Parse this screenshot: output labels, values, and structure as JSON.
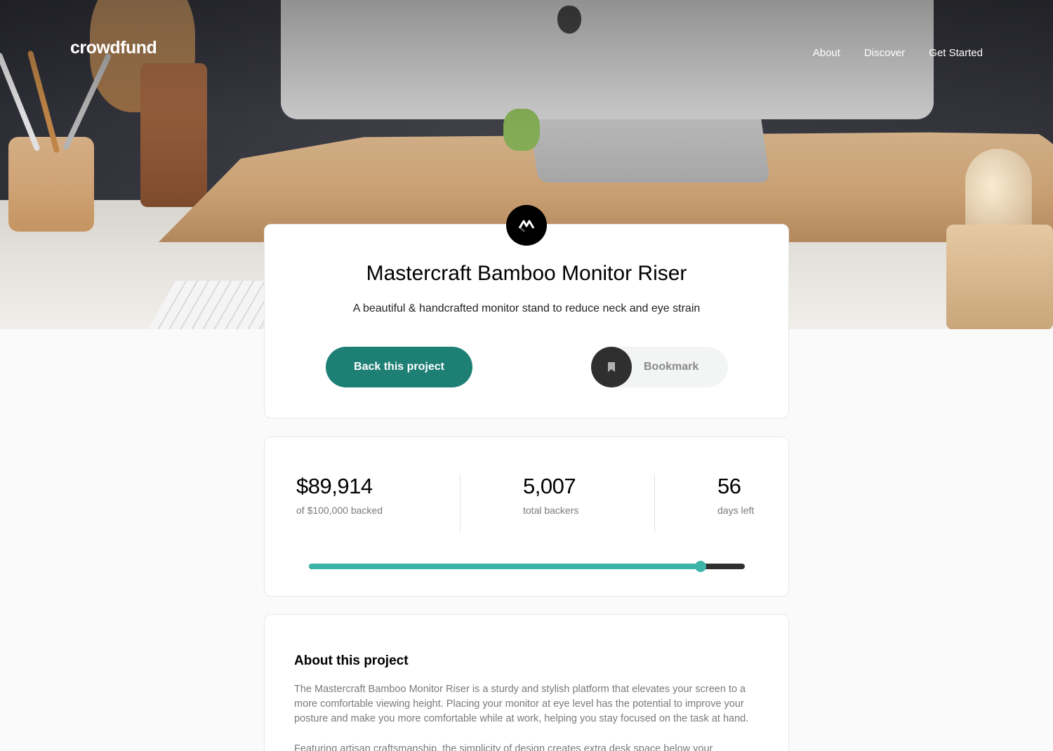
{
  "header": {
    "logo": "crowdfund",
    "nav": [
      "About",
      "Discover",
      "Get Started"
    ]
  },
  "hero": {
    "image": "desk-setup-photo"
  },
  "project": {
    "logo_icon": "mastercraft-logo-icon",
    "title": "Mastercraft Bamboo Monitor Riser",
    "subtitle": "A beautiful & handcrafted monitor stand to reduce neck and eye strain",
    "back_button": "Back this project",
    "bookmark_button": "Bookmark",
    "bookmark_icon": "bookmark-icon"
  },
  "stats": {
    "backed_value": "$89,914",
    "backed_label": "of $100,000 backed",
    "backers_value": "5,007",
    "backers_label": "total backers",
    "days_value": "56",
    "days_label": "days left",
    "progress_fraction": 0.89914
  },
  "about": {
    "title": "About this project",
    "paragraphs": [
      "The Mastercraft Bamboo Monitor Riser is a sturdy and stylish platform that elevates your screen to a more comfortable viewing height. Placing your monitor at eye level has the potential to improve your posture and make you more comfortable while at work, helping you stay focused on the task at hand.",
      "Featuring artisan craftsmanship, the simplicity of design creates extra desk space below your"
    ]
  },
  "colors": {
    "accent": "#3cb4a8",
    "accent_dark": "#1e7f75",
    "text_muted": "#7a7a7a",
    "background": "#fafafa"
  }
}
